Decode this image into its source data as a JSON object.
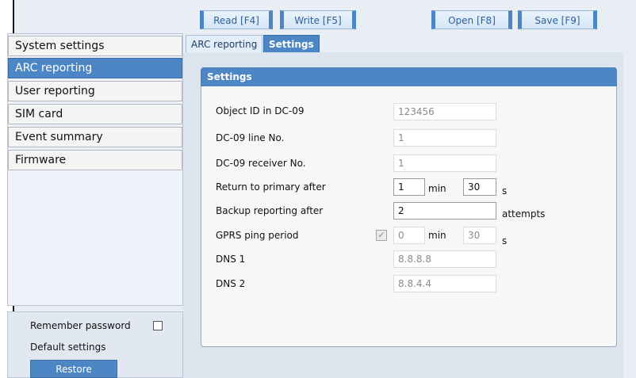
{
  "toolbar": {
    "read_label": "Read [F4]",
    "write_label": "Write [F5]",
    "open_label": "Open [F8]",
    "save_label": "Save [F9]"
  },
  "sidebar": {
    "items": [
      {
        "label": "System settings"
      },
      {
        "label": "ARC reporting"
      },
      {
        "label": "User reporting"
      },
      {
        "label": "SIM card"
      },
      {
        "label": "Event summary"
      },
      {
        "label": "Firmware"
      }
    ],
    "active_index": 1
  },
  "bottom_panel": {
    "remember_password_label": "Remember password",
    "default_settings_label": "Default settings",
    "restore_label": "Restore"
  },
  "tabs": [
    {
      "label": "ARC reporting",
      "active": false
    },
    {
      "label": "Settings",
      "active": true
    }
  ],
  "settings": {
    "header": "Settings",
    "object_id": {
      "label": "Object ID in DC-09",
      "value": "123456"
    },
    "line_no": {
      "label": "DC-09 line No.",
      "value": "1"
    },
    "receiver_no": {
      "label": "DC-09 receiver No.",
      "value": "1"
    },
    "return_primary": {
      "label": "Return to primary after",
      "min_value": "1",
      "min_unit": "min",
      "sec_value": "30",
      "sec_unit": "s"
    },
    "backup_reporting": {
      "label": "Backup reporting after",
      "value": "2",
      "unit": "attempts"
    },
    "gprs_ping": {
      "label": "GPRS ping period",
      "checkbox_mark": "✓",
      "min_value": "0",
      "min_unit": "min",
      "sec_value": "30",
      "sec_unit": "s"
    },
    "dns1": {
      "label": "DNS 1",
      "value": "8.8.8.8"
    },
    "dns2": {
      "label": "DNS 2",
      "value": "8.8.4.4"
    }
  },
  "colors": {
    "accent": "#4d86c4",
    "panel_bg": "#e9eef5"
  }
}
